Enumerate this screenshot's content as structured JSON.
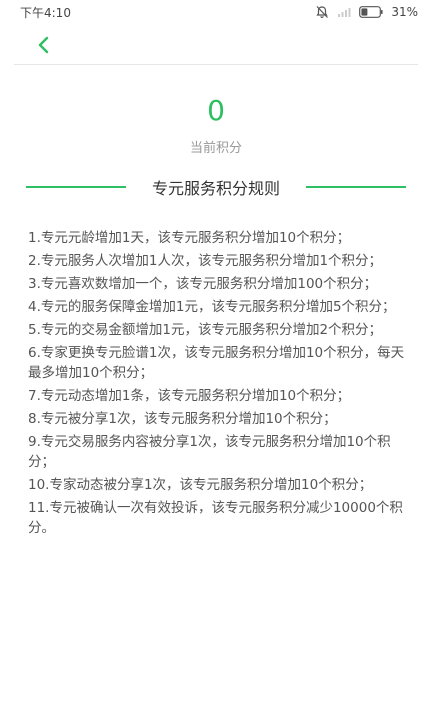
{
  "status": {
    "time": "下午4:10",
    "battery": "31%",
    "icons": [
      "mute-icon",
      "signal-icon",
      "battery-icon"
    ]
  },
  "nav": {
    "back_icon": "chevron-left-icon"
  },
  "points": {
    "value": "0",
    "label": "当前积分"
  },
  "section": {
    "title": "专元服务积分规则"
  },
  "rules": [
    "1.专元元龄增加1天，该专元服务积分增加10个积分；",
    "2.专元服务人次增加1人次，该专元服务积分增加1个积分；",
    "3.专元喜欢数增加一个，该专元服务积分增加100个积分；",
    "4.专元的服务保障金增加1元，该专元服务积分增加5个积分；",
    "5.专元的交易金额增加1元，该专元服务积分增加2个积分；",
    "6.专家更换专元脸谱1次，该专元服务积分增加10个积分，每天最多增加10个积分；",
    "7.专元动态增加1条，该专元服务积分增加10个积分；",
    "8.专元被分享1次，该专元服务积分增加10个积分；",
    "9.专元交易服务内容被分享1次，该专元服务积分增加10个积分；",
    "10.专家动态被分享1次，该专元服务积分增加10个积分；",
    "11.专元被确认一次有效投诉，该专元服务积分减少10000个积分。"
  ],
  "colors": {
    "accent": "#2dbf62",
    "text": "#555555",
    "label": "#999999"
  }
}
